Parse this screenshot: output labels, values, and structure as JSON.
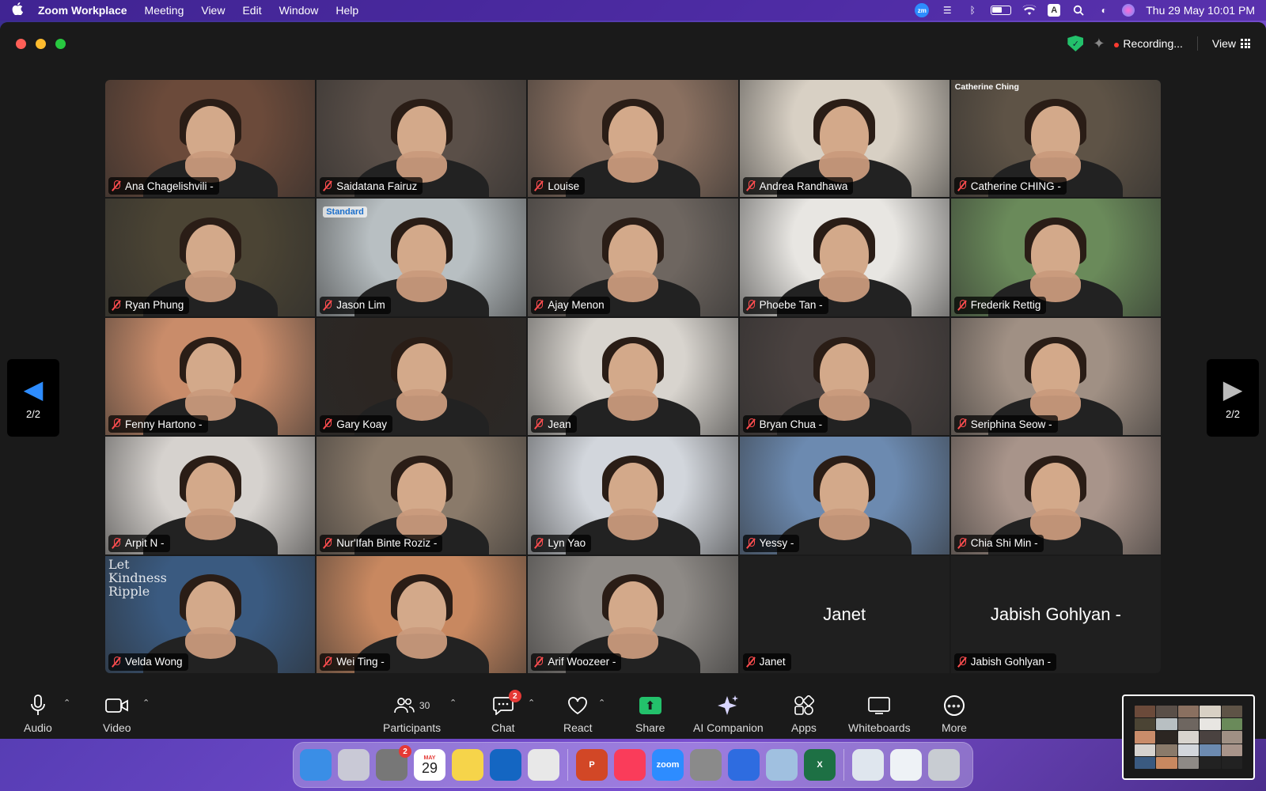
{
  "menubar": {
    "app_name": "Zoom Workplace",
    "items": [
      "Meeting",
      "View",
      "Edit",
      "Window",
      "Help"
    ],
    "date_time": "Thu 29 May  10:01 PM",
    "status_icons": [
      "zoom-icon",
      "control-center-list-icon",
      "bluetooth-icon",
      "battery-icon",
      "wifi-icon",
      "input-source-icon",
      "spotlight-search-icon",
      "control-center-icon",
      "siri-icon"
    ],
    "input_source": "A",
    "zoom_badge": "zm"
  },
  "window": {
    "recording_label": "Recording...",
    "view_label": "View"
  },
  "pager": {
    "left_label": "2/2",
    "right_label": "2/2"
  },
  "participants": [
    {
      "name": "Ana Chagelishvili -",
      "bg": "#6b4a3a"
    },
    {
      "name": "Saidatana Fairuz",
      "bg": "#5a4f48"
    },
    {
      "name": "Louise",
      "bg": "#8a7060"
    },
    {
      "name": "Andrea Randhawa",
      "bg": "#d8d0c4"
    },
    {
      "name": "Catherine CHING -",
      "bg": "#5e5346",
      "corner_label": "Catherine Ching"
    },
    {
      "name": "Ryan Phung",
      "bg": "#4b4434"
    },
    {
      "name": "Jason Lim",
      "bg": "#b8bfc2",
      "logo": "Standard"
    },
    {
      "name": "Ajay Menon",
      "bg": "#6e6660"
    },
    {
      "name": "Phoebe Tan -",
      "bg": "#e8e6e2"
    },
    {
      "name": "Frederik Rettig",
      "bg": "#6a8a5a"
    },
    {
      "name": "Fenny Hartono -",
      "bg": "#c98c6a"
    },
    {
      "name": "Gary Koay",
      "bg": "#2c2622"
    },
    {
      "name": "Jean",
      "bg": "#d8d4ce"
    },
    {
      "name": "Bryan Chua -",
      "bg": "#4a4240"
    },
    {
      "name": "Seriphina Seow -",
      "bg": "#a09084"
    },
    {
      "name": "Arpit N -",
      "bg": "#d6d2ce"
    },
    {
      "name": "Nur'Ifah Binte Roziz -",
      "bg": "#8a7a6a"
    },
    {
      "name": "Lyn Yao",
      "bg": "#d2d6dc"
    },
    {
      "name": "Yessy -",
      "bg": "#6c8ab0"
    },
    {
      "name": "Chia Shi Min -",
      "bg": "#a8948a"
    },
    {
      "name": "Velda Wong",
      "bg": "#3a5a80",
      "overlay": "Let Kindness Ripple"
    },
    {
      "name": "Wei Ting -",
      "bg": "#c88860"
    },
    {
      "name": "Arif Woozeer -",
      "bg": "#8e8a86"
    },
    {
      "name": "Janet",
      "bg": "#1f1f1f",
      "video_off": true,
      "big_name": "Janet"
    },
    {
      "name": "Jabish Gohlyan -",
      "bg": "#1f1f1f",
      "video_off": true,
      "big_name": "Jabish Gohlyan -"
    }
  ],
  "toolbar": {
    "audio": "Audio",
    "video": "Video",
    "participants": "Participants",
    "participants_count": "30",
    "chat": "Chat",
    "chat_badge": "2",
    "react": "React",
    "share": "Share",
    "ai_companion": "AI Companion",
    "apps": "Apps",
    "whiteboards": "Whiteboards",
    "more": "More"
  },
  "dock": {
    "apps": [
      {
        "name": "finder-icon",
        "color": "#3a8ee6"
      },
      {
        "name": "launchpad-icon",
        "color": "#c9c9d6"
      },
      {
        "name": "system-settings-icon",
        "color": "#777",
        "badge": "2"
      },
      {
        "name": "calendar-icon",
        "color": "#ffffff",
        "label": "29",
        "month": "MAY"
      },
      {
        "name": "notes-icon",
        "color": "#f6d44a"
      },
      {
        "name": "outlook-icon",
        "color": "#1466c2"
      },
      {
        "name": "chrome-icon",
        "color": "#e8e8e8"
      },
      {
        "name": "powerpoint-icon",
        "color": "#d24726",
        "label": "P"
      },
      {
        "name": "music-icon",
        "color": "#fa3c5a"
      },
      {
        "name": "zoom-icon",
        "color": "#2d8cff",
        "label": "zoom"
      },
      {
        "name": "calculator-icon",
        "color": "#8a8a8a"
      },
      {
        "name": "ticktick-icon",
        "color": "#2e6ce0"
      },
      {
        "name": "preview-icon",
        "color": "#a0c0e0"
      },
      {
        "name": "excel-icon",
        "color": "#1d7044",
        "label": "X"
      },
      {
        "name": "window-preview-1-icon",
        "color": "#dfe6ee"
      },
      {
        "name": "window-preview-2-icon",
        "color": "#eef2f6"
      },
      {
        "name": "trash-icon",
        "color": "#c8ccd2"
      }
    ]
  }
}
